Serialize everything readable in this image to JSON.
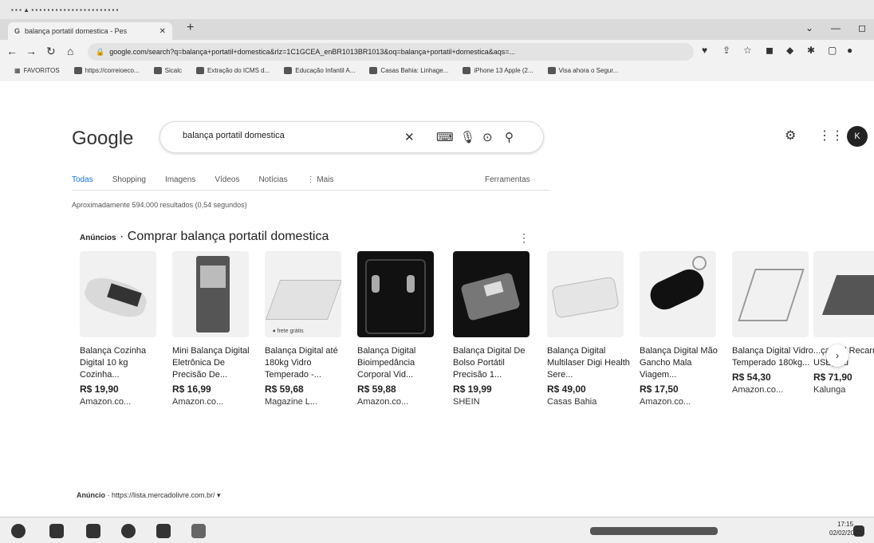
{
  "browser": {
    "tab_title": "balança portatil domestica - Pes",
    "tab_favicon": "G",
    "url": "google.com/search?q=balança+portatil+domestica&rlz=1C1GCEA_enBR1013BR1013&oq=balança+portatil+domestica&aqs=...",
    "bookmarks": [
      "FAVORITOS",
      "https://correioeco...",
      "Sicalc",
      "Extração do ICMS d...",
      "Educação Infantil A...",
      "Casas Bahia: Linhage...",
      "iPhone 13 Apple (2...",
      "Visa ahora o Segur..."
    ]
  },
  "google": {
    "logo": "Google",
    "query": "balança portatil domestica",
    "tabs": [
      "Todas",
      "Shopping",
      "Imagens",
      "Vídeos",
      "Notícias",
      "⋮ Mais"
    ],
    "tools": "Ferramentas",
    "result_stats": "Aproximadamente 594.000 resultados (0,54 segundos)",
    "ads_label": "Anúncios",
    "ads_title": "Comprar balança portatil domestica",
    "avatar_letter": "K",
    "bottom_ad_label": "Anúncio",
    "bottom_ad_url": "https://lista.mercadolivre.com.br/"
  },
  "products": [
    {
      "title": "Balança Cozinha Digital 10 kg Cozinha...",
      "price": "R$ 19,90",
      "store": "Amazon.co..."
    },
    {
      "title": "Mini Balança Digital Eletrônica De Precisão De...",
      "price": "R$ 16,99",
      "store": "Amazon.co..."
    },
    {
      "title": "Balança Digital até 180kg Vidro Temperado -...",
      "price": "R$ 59,68",
      "store": "Magazine L...",
      "tag": "♦ frete grátis"
    },
    {
      "title": "Balança Digital Bioimpedância Corporal Vid...",
      "price": "R$ 59,88",
      "store": "Amazon.co..."
    },
    {
      "title": "Balança Digital De Bolso Portátil Precisão 1...",
      "price": "R$ 19,99",
      "store": "SHEIN"
    },
    {
      "title": "Balança Digital Multilaser Digi Health Sere...",
      "price": "R$ 49,00",
      "store": "Casas Bahia"
    },
    {
      "title": "Balança Digital Mão Gancho Mala Viagem...",
      "price": "R$ 17,50",
      "store": "Amazon.co..."
    },
    {
      "title": "Balança Digital Vidro Temperado 180kg...",
      "price": "R$ 54,30",
      "store": "Amazon.co..."
    },
    {
      "title": "...ça ...al Recarreg USB, Mu",
      "price": "R$ 71,90",
      "store": "Kalunga"
    }
  ],
  "clock": {
    "time": "17:15",
    "date": "02/02/2023"
  }
}
